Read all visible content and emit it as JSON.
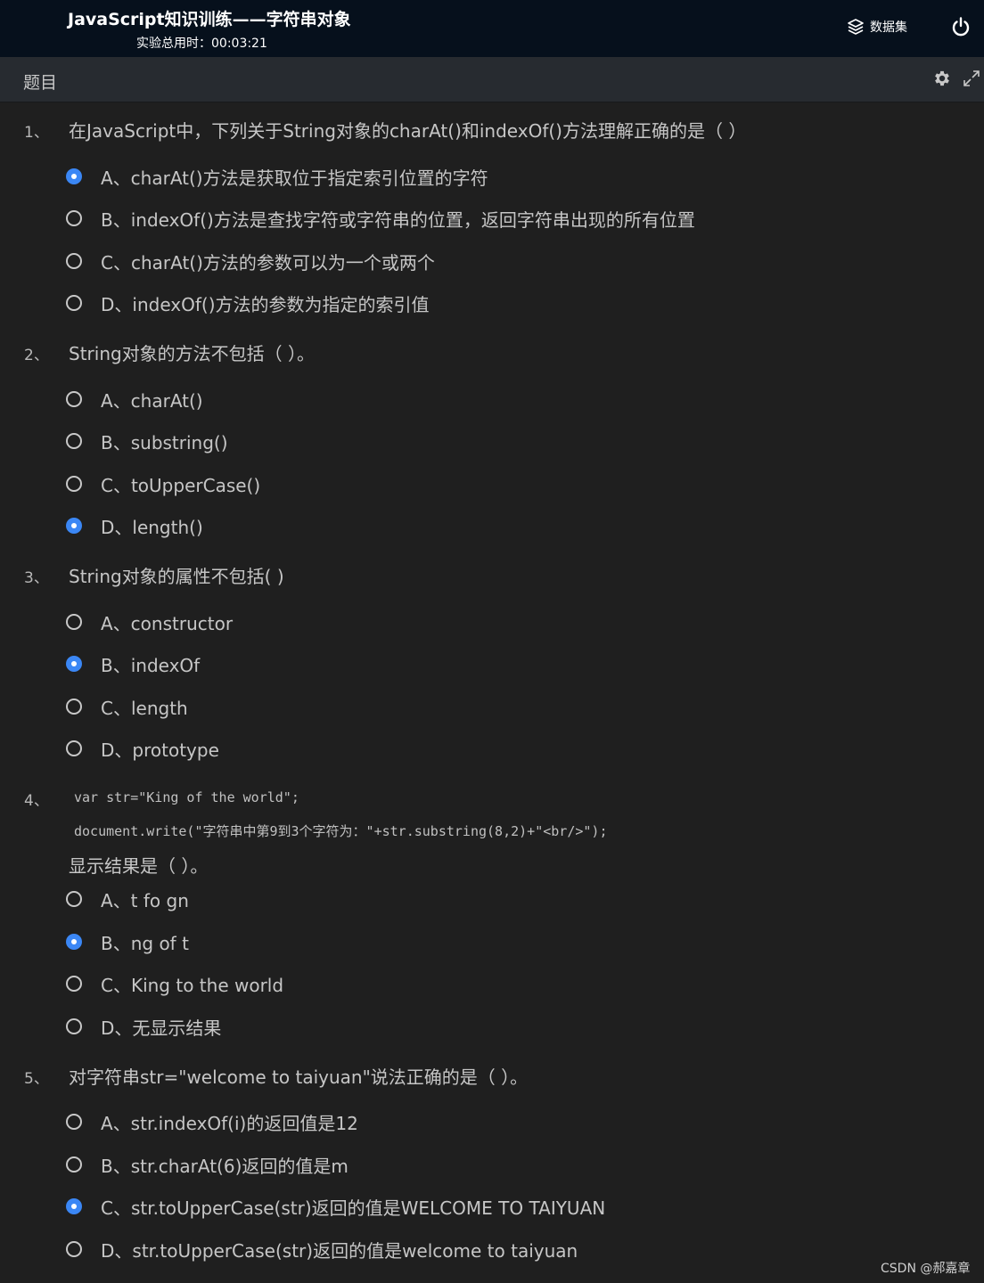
{
  "header": {
    "title": "JavaScript知识训练——字符串对象",
    "timer": "实验总用时：00:03:21",
    "dataset_label": "数据集",
    "icons": [
      "layers-icon",
      "power-icon"
    ]
  },
  "panel": {
    "title": "题目",
    "icons": [
      "gear-icon",
      "expand-icon"
    ]
  },
  "accent_color": "#3b87f5",
  "questions": [
    {
      "number": "1、",
      "text": "在JavaScript中，下列关于String对象的charAt()和indexOf()方法理解正确的是（    ）",
      "options": [
        {
          "label": "A、charAt()方法是获取位于指定索引位置的字符",
          "selected": true
        },
        {
          "label": "B、indexOf()方法是查找字符或字符串的位置，返回字符串出现的所有位置",
          "selected": false
        },
        {
          "label": "C、charAt()方法的参数可以为一个或两个",
          "selected": false
        },
        {
          "label": "D、indexOf()方法的参数为指定的索引值",
          "selected": false
        }
      ]
    },
    {
      "number": "2、",
      "text": "String对象的方法不包括（      ）。",
      "options": [
        {
          "label": "A、charAt()",
          "selected": false
        },
        {
          "label": "B、substring()",
          "selected": false
        },
        {
          "label": "C、toUpperCase()",
          "selected": false
        },
        {
          "label": "D、length()",
          "selected": true
        }
      ]
    },
    {
      "number": "3、",
      "text": "String对象的属性不包括(    )",
      "options": [
        {
          "label": "A、constructor",
          "selected": false
        },
        {
          "label": "B、indexOf",
          "selected": true
        },
        {
          "label": "C、length",
          "selected": false
        },
        {
          "label": "D、prototype",
          "selected": false
        }
      ]
    },
    {
      "number": "4、",
      "code": [
        "var str=\"King of the world\";",
        "document.write(\"字符串中第9到3个字符为：\"+str.substring(8,2)+\"<br/>\");"
      ],
      "text": "显示结果是（    ）。",
      "options": [
        {
          "label": "A、t fo gn",
          "selected": false
        },
        {
          "label": "B、ng of t",
          "selected": true
        },
        {
          "label": "C、King to the world",
          "selected": false
        },
        {
          "label": "D、无显示结果",
          "selected": false
        }
      ]
    },
    {
      "number": "5、",
      "text": "对字符串str=\"welcome to taiyuan\"说法正确的是（   ）。",
      "options": [
        {
          "label": "A、str.indexOf(i)的返回值是12",
          "selected": false
        },
        {
          "label": "B、str.charAt(6)返回的值是m",
          "selected": false
        },
        {
          "label": "C、str.toUpperCase(str)返回的值是WELCOME TO TAIYUAN",
          "selected": true
        },
        {
          "label": "D、str.toUpperCase(str)返回的值是welcome to taiyuan",
          "selected": false
        }
      ]
    }
  ],
  "watermark": "CSDN @郝嘉章"
}
